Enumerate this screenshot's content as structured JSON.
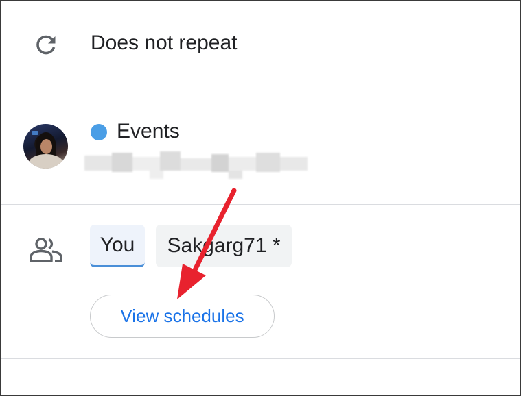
{
  "repeat": {
    "label": "Does not repeat",
    "icon": "repeat-icon"
  },
  "calendar": {
    "name": "Events",
    "dot_color": "#4a9ee6",
    "email_redacted": true
  },
  "guests": {
    "icon": "people-icon",
    "chips": [
      {
        "label": "You",
        "selected": true
      },
      {
        "label": "Sakgarg71 *",
        "selected": false
      }
    ],
    "view_schedules_label": "View schedules"
  },
  "annotation": {
    "color": "#e8222e",
    "icon": "red-arrow"
  },
  "colors": {
    "accent": "#1a73e8",
    "divider": "#dadce0",
    "text": "#202124"
  }
}
